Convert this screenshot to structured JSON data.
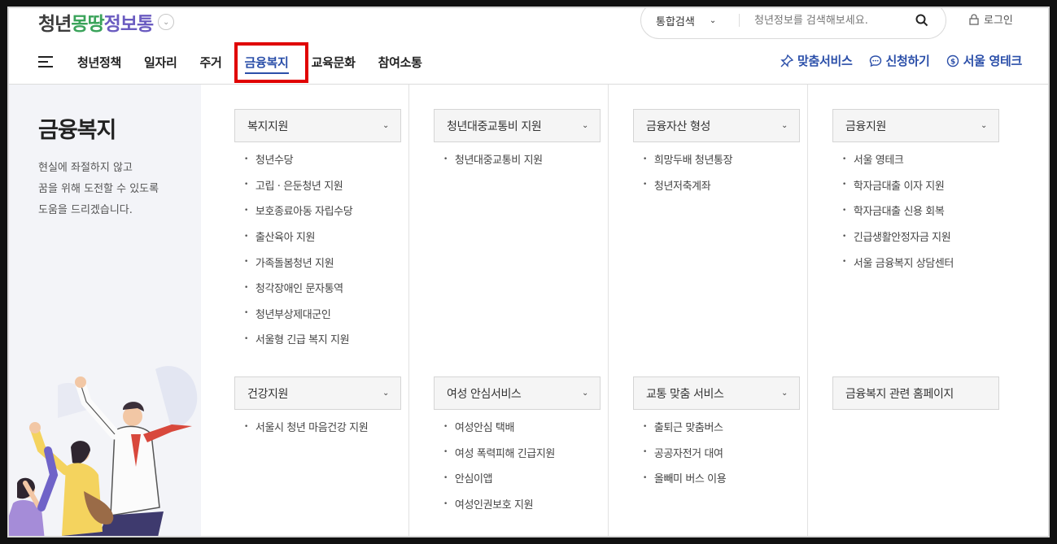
{
  "header": {
    "logo": {
      "part1": "청년",
      "part2": "몽땅",
      "part3": "정보통"
    },
    "search": {
      "scope": "통합검색",
      "placeholder": "청년정보를 검색해보세요."
    },
    "login": "로그인",
    "nav": [
      "청년정책",
      "일자리",
      "주거",
      "금융복지",
      "교육문화",
      "참여소통"
    ],
    "active_nav": "금융복지",
    "quick": [
      {
        "label": "맞춤서비스",
        "icon": "pin-icon"
      },
      {
        "label": "신청하기",
        "icon": "chat-icon"
      },
      {
        "label": "서울 영테크",
        "icon": "coin-icon"
      }
    ]
  },
  "sidebar": {
    "title": "금융복지",
    "desc1": "현실에 좌절하지 않고",
    "desc2": "꿈을 위해 도전할 수 있도록",
    "desc3": "도움을 드리겠습니다."
  },
  "columns": [
    {
      "groups": [
        {
          "title": "복지지원",
          "has_chevron": true,
          "items": [
            "청년수당",
            "고립 · 은둔청년 지원",
            "보호종료아동 자립수당",
            "출산육아 지원",
            "가족돌봄청년 지원",
            "청각장애인 문자통역",
            "청년부상제대군인",
            "서울형 긴급 복지 지원"
          ]
        },
        {
          "title": "건강지원",
          "has_chevron": true,
          "items": [
            "서울시 청년 마음건강 지원"
          ]
        }
      ]
    },
    {
      "groups": [
        {
          "title": "청년대중교통비 지원",
          "has_chevron": true,
          "items": [
            "청년대중교통비 지원"
          ]
        },
        {
          "title": "여성 안심서비스",
          "has_chevron": true,
          "items": [
            "여성안심 택배",
            "여성 폭력피해 긴급지원",
            "안심이앱",
            "여성인권보호 지원"
          ]
        }
      ]
    },
    {
      "groups": [
        {
          "title": "금융자산 형성",
          "has_chevron": true,
          "items": [
            "희망두배 청년통장",
            "청년저축계좌"
          ]
        },
        {
          "title": "교통 맞춤 서비스",
          "has_chevron": true,
          "items": [
            "출퇴근 맞춤버스",
            "공공자전거 대여",
            "올빼미 버스 이용"
          ]
        }
      ]
    },
    {
      "groups": [
        {
          "title": "금융지원",
          "has_chevron": true,
          "items": [
            "서울 영테크",
            "학자금대출 이자 지원",
            "학자금대출 신용 회복",
            "긴급생활안정자금 지원",
            "서울 금융복지 상담센터"
          ]
        },
        {
          "title": "금융복지 관련 홈페이지",
          "has_chevron": false,
          "items": []
        }
      ]
    }
  ],
  "colors": {
    "accent": "#2b4fa9",
    "highlight": "#e00000",
    "sidebar_bg": "#f3f4f8"
  }
}
